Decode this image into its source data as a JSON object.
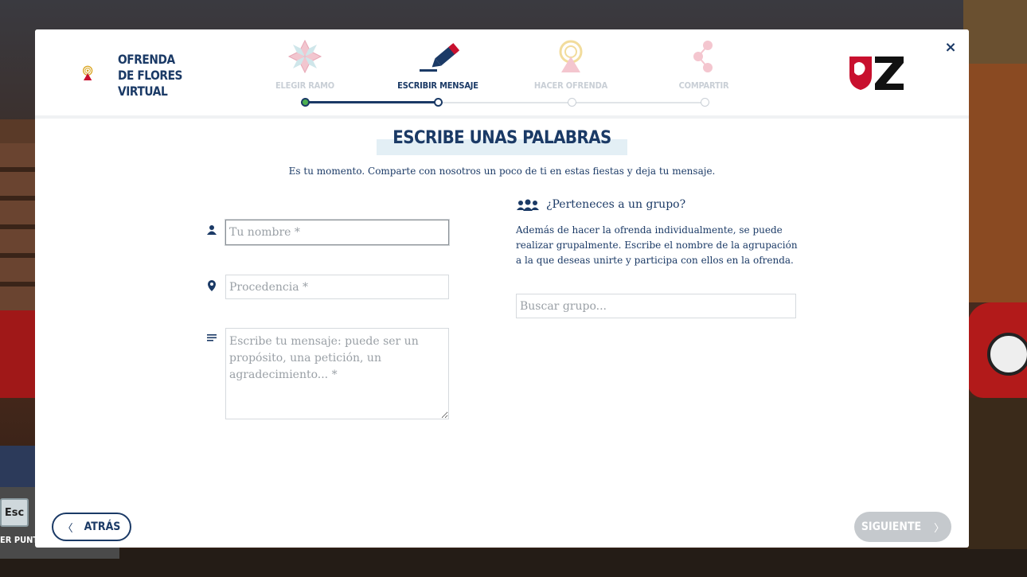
{
  "brand": {
    "name_lines": [
      "OFRENDA",
      "DE FLORES",
      "VIRTUAL"
    ]
  },
  "steps": [
    {
      "label": "ELEGIR RAMO",
      "icon": "flower-icon",
      "state": "done"
    },
    {
      "label": "ESCRIBIR MENSAJE",
      "icon": "pencil-icon",
      "state": "active"
    },
    {
      "label": "HACER OFRENDA",
      "icon": "offering-icon",
      "state": "pending"
    },
    {
      "label": "COMPARTIR",
      "icon": "share-icon",
      "state": "pending"
    }
  ],
  "close_label": "×",
  "main": {
    "title": "ESCRIBE UNAS PALABRAS",
    "intro": "Es tu momento. Comparte con nosotros un poco de ti en estas fiestas y deja tu mensaje."
  },
  "form": {
    "name_placeholder": "Tu nombre *",
    "origin_placeholder": "Procedencia *",
    "message_placeholder": "Escribe tu mensaje: puede ser un propósito, una petición, un agradecimiento... *"
  },
  "group": {
    "title": "¿Perteneces a un grupo?",
    "description": "Además de hacer la ofrenda individualmente, se puede realizar grupalmente. Escribe el nombre de la agrupación a la que deseas unirte y participa con ellos en la ofrenda.",
    "search_placeholder": "Buscar grupo..."
  },
  "footer": {
    "back_label": "ATRÁS",
    "next_label": "SIGUIENTE",
    "back_chevron": "〈",
    "next_chevron": "〉"
  },
  "esc_hint": {
    "key": "Esc",
    "text": "ER PUNTERO"
  },
  "colors": {
    "primary": "#1b3a66",
    "accent_red": "#c8102e",
    "accent_gold": "#d9a520",
    "disabled": "#c5c9cd"
  }
}
